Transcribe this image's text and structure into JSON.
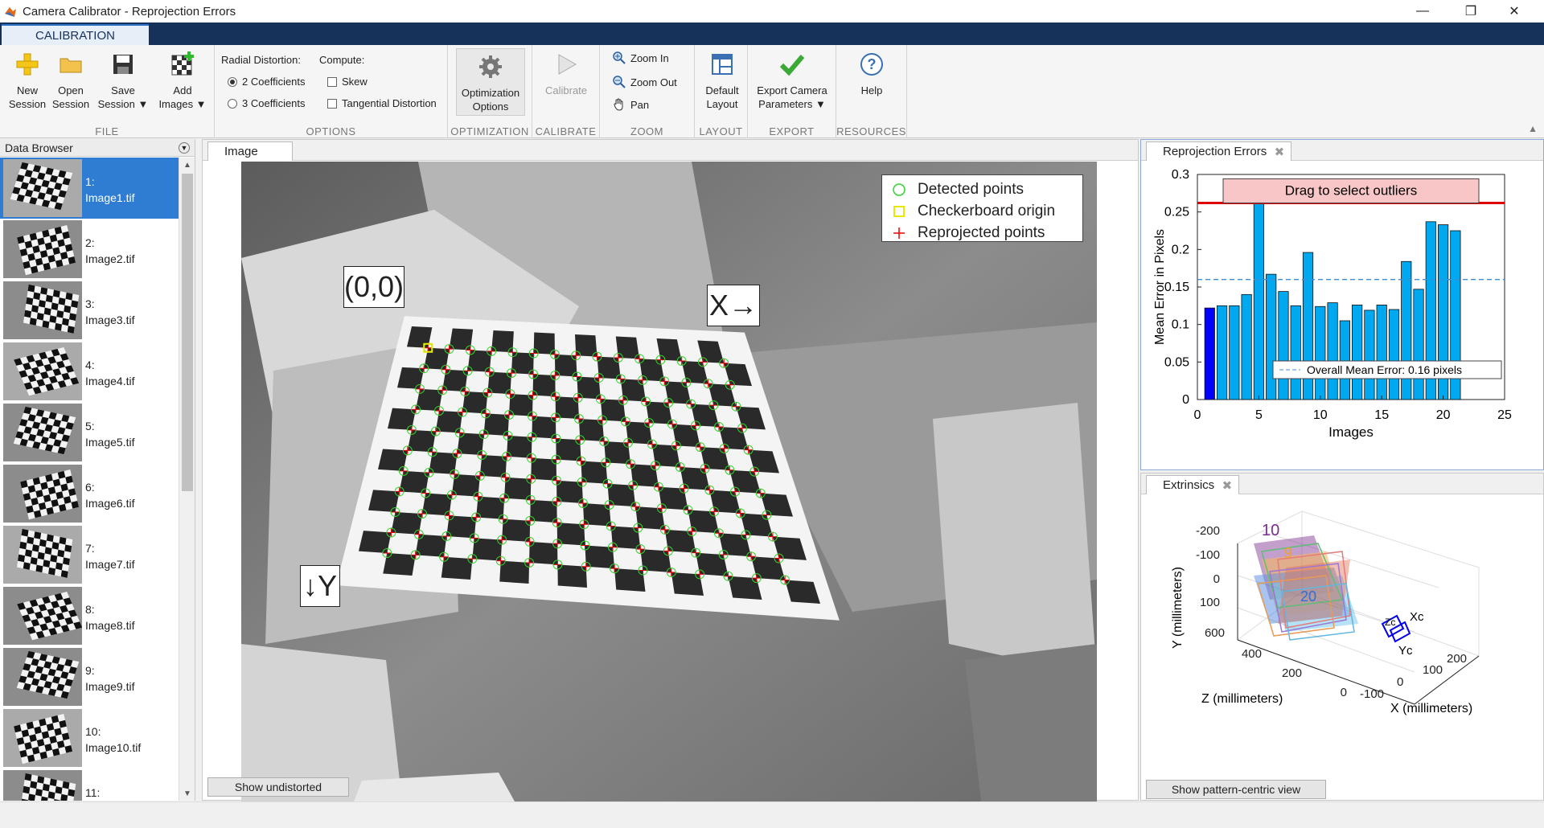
{
  "window": {
    "title": "Camera Calibrator - Reprojection Errors",
    "minimize": "—",
    "restore": "❐",
    "close": "✕"
  },
  "ribbon_tab": "CALIBRATION",
  "file": {
    "new_session": [
      "New",
      "Session"
    ],
    "open_session": [
      "Open",
      "Session"
    ],
    "save_session": [
      "Save",
      "Session ▼"
    ],
    "add_images": [
      "Add",
      "Images ▼"
    ],
    "label": "FILE"
  },
  "options": {
    "radial_label": "Radial Distortion:",
    "compute_label": "Compute:",
    "coef2": "2 Coefficients",
    "coef3": "3 Coefficients",
    "skew": "Skew",
    "tangential": "Tangential Distortion",
    "label": "OPTIONS"
  },
  "optimization": {
    "btn": [
      "Optimization",
      "Options"
    ],
    "label": "OPTIMIZATION"
  },
  "calibrate": {
    "btn": "Calibrate",
    "label": "CALIBRATE"
  },
  "zoom": {
    "zoom_in": "Zoom In",
    "zoom_out": "Zoom Out",
    "pan": "Pan",
    "label": "ZOOM"
  },
  "layout": {
    "btn": [
      "Default",
      "Layout"
    ],
    "label": "LAYOUT"
  },
  "export": {
    "btn": [
      "Export Camera",
      "Parameters ▼"
    ],
    "label": "EXPORT"
  },
  "resources": {
    "btn": "Help",
    "label": "RESOURCES"
  },
  "data_browser": {
    "title": "Data Browser",
    "items": [
      {
        "num": "1:",
        "name": "Image1.tif"
      },
      {
        "num": "2:",
        "name": "Image2.tif"
      },
      {
        "num": "3:",
        "name": "Image3.tif"
      },
      {
        "num": "4:",
        "name": "Image4.tif"
      },
      {
        "num": "5:",
        "name": "Image5.tif"
      },
      {
        "num": "6:",
        "name": "Image6.tif"
      },
      {
        "num": "7:",
        "name": "Image7.tif"
      },
      {
        "num": "8:",
        "name": "Image8.tif"
      },
      {
        "num": "9:",
        "name": "Image9.tif"
      },
      {
        "num": "10:",
        "name": "Image10.tif"
      },
      {
        "num": "11:",
        "name": ""
      }
    ]
  },
  "image_panel": {
    "tab": "Image",
    "legend": [
      "Detected points",
      "Checkerboard origin",
      "Reprojected points"
    ],
    "origin_label": "(0,0)",
    "x_label": "X→",
    "y_label": "↓Y",
    "show_undistorted": "Show undistorted"
  },
  "reprojection": {
    "tab": "Reprojection Errors",
    "drag_label": "Drag to select outliers",
    "overall_label": "Overall Mean Error: 0.16 pixels",
    "ylabel": "Mean Error in Pixels",
    "xlabel": "Images",
    "yticks": [
      "0",
      "0.05",
      "0.1",
      "0.15",
      "0.2",
      "0.25",
      "0.3"
    ],
    "xticks": [
      "0",
      "5",
      "10",
      "15",
      "20",
      "25"
    ]
  },
  "chart_data": {
    "type": "bar",
    "categories": [
      1,
      2,
      3,
      4,
      5,
      6,
      7,
      8,
      9,
      10,
      11,
      12,
      13,
      14,
      15,
      16,
      17,
      18,
      19,
      20
    ],
    "values": [
      0.122,
      0.125,
      0.125,
      0.14,
      0.265,
      0.167,
      0.144,
      0.125,
      0.196,
      0.124,
      0.129,
      0.105,
      0.126,
      0.119,
      0.126,
      0.12,
      0.184,
      0.147,
      0.237,
      0.233,
      0.225
    ],
    "xlabel": "Images",
    "ylabel": "Mean Error in Pixels",
    "ylim": [
      0,
      0.3
    ],
    "xlim": [
      0,
      25
    ],
    "overall_mean": 0.16,
    "outlier_threshold": 0.262,
    "colors": {
      "bar": "#00a8f0",
      "selected_bar": "#0000ff",
      "threshold": "#e00000",
      "mean": "#3a8fd6"
    }
  },
  "extrinsics": {
    "tab": "Extrinsics",
    "ylabel": "Y (millimeters)",
    "zlabel": "Z (millimeters)",
    "xlabel": "X (millimeters)",
    "yticks": [
      "-200",
      "-100",
      "0",
      "100"
    ],
    "zticks": [
      "600",
      "400",
      "200",
      "0"
    ],
    "xticks": [
      "-100",
      "0",
      "100",
      "200"
    ],
    "labels": [
      "10",
      "9",
      "20"
    ],
    "camera_axes": [
      "Xc",
      "Yc",
      "Zc"
    ],
    "btn": "Show pattern-centric view"
  }
}
